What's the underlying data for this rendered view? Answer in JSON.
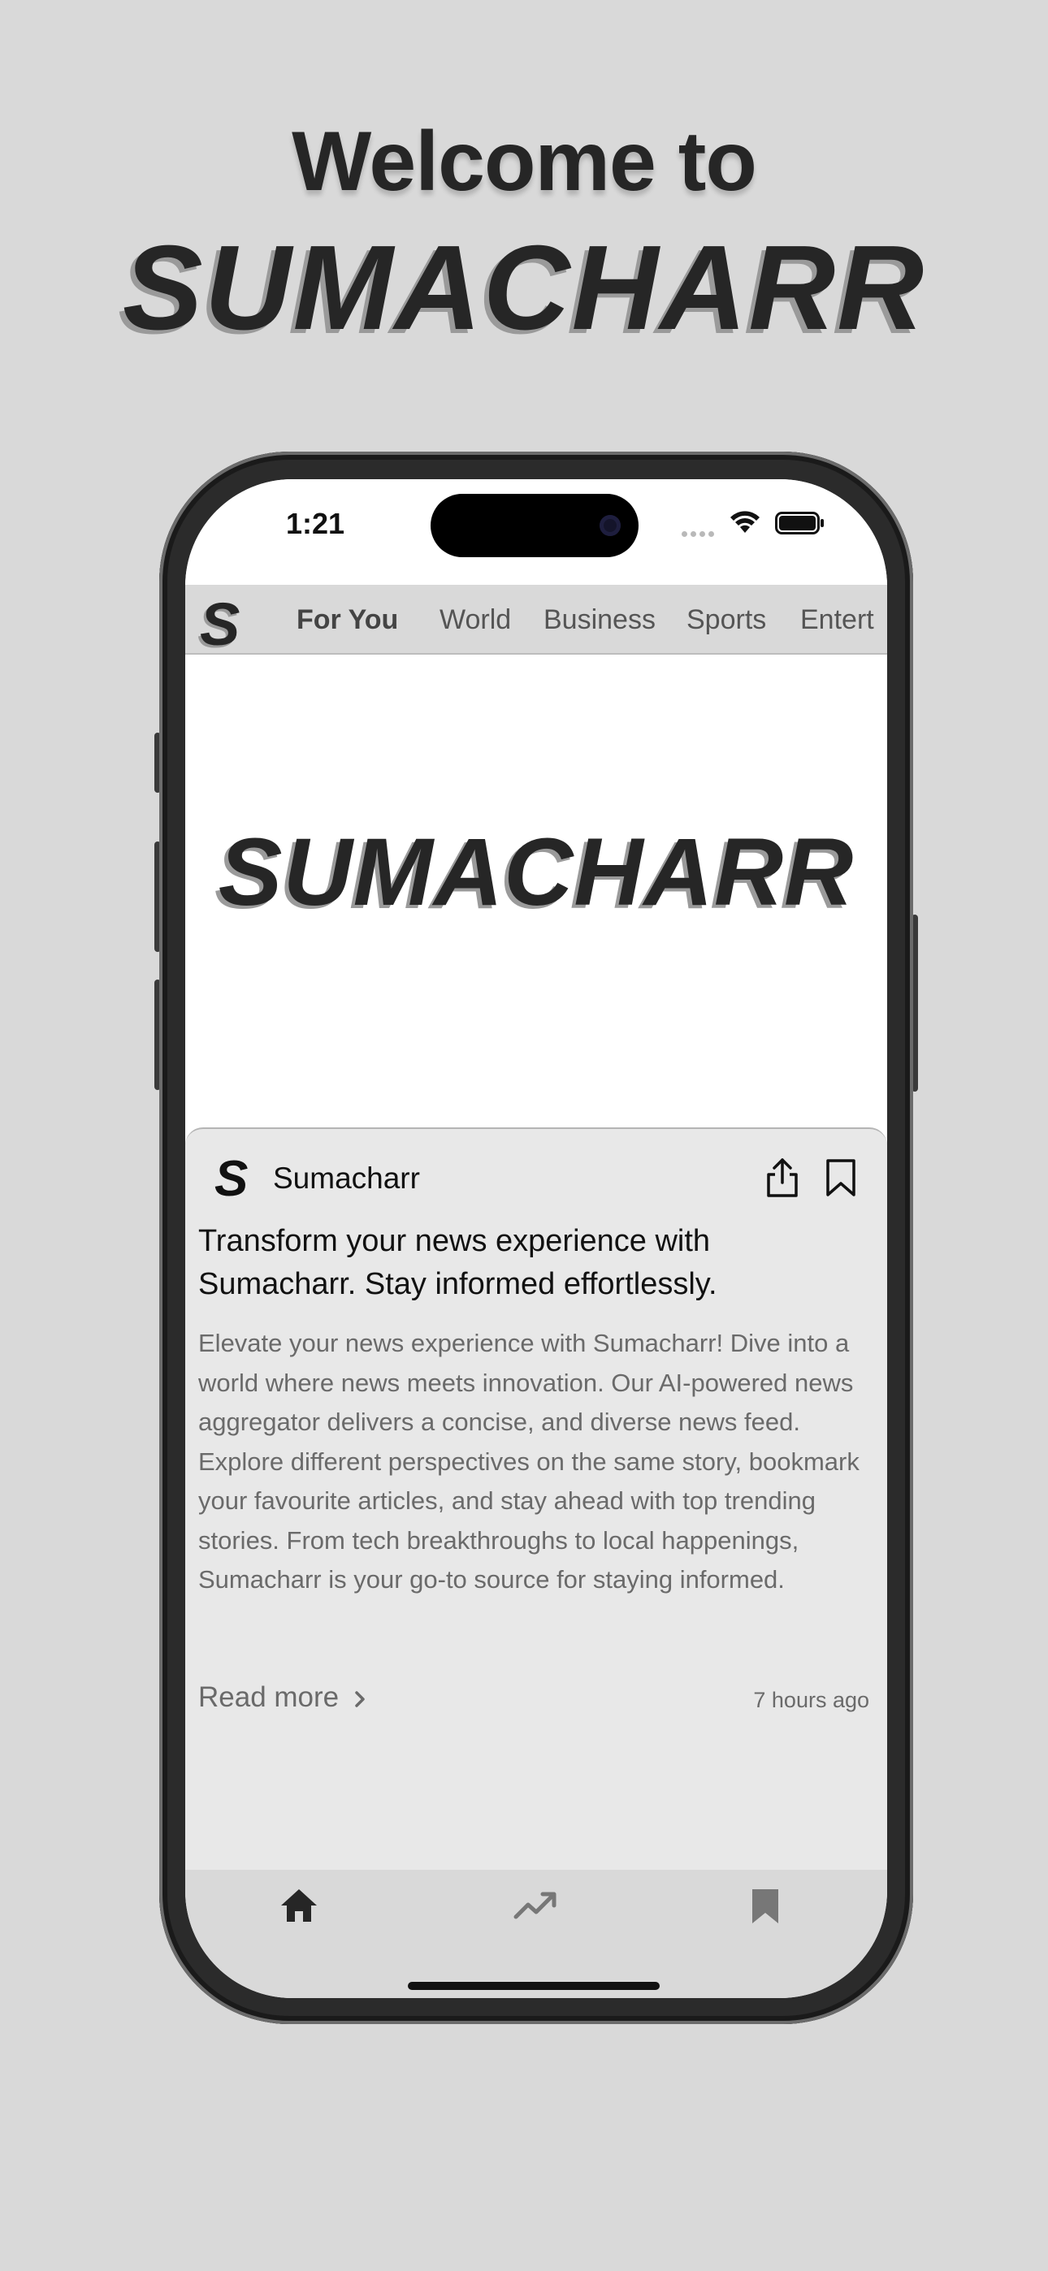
{
  "header": {
    "welcome": "Welcome to",
    "brand": "SUMACHARR"
  },
  "status_bar": {
    "time": "1:21"
  },
  "app": {
    "logo_letter": "S",
    "tabs": [
      {
        "label": "For You",
        "active": true
      },
      {
        "label": "World"
      },
      {
        "label": "Business"
      },
      {
        "label": "Sports"
      },
      {
        "label": "Entert"
      }
    ],
    "hero_brand": "SUMACHARR"
  },
  "article": {
    "source_logo": "S",
    "source": "Sumacharr",
    "title": "Transform your news experience with Sumacharr. Stay informed effortlessly.",
    "body": "Elevate your news experience with Sumacharr! Dive into a world where news meets innovation. Our AI-powered news aggregator delivers a concise, and diverse news feed. Explore different perspectives on the same story, bookmark your favourite articles, and stay ahead with top trending stories. From tech breakthroughs to local happenings, Sumacharr is your go-to source for staying informed.",
    "read_more": "Read more",
    "timestamp": "7 hours ago",
    "icons": [
      "share-icon",
      "bookmark-icon"
    ]
  },
  "bottom_nav": {
    "items": [
      {
        "icon": "home-icon",
        "active": true
      },
      {
        "icon": "trending-icon"
      },
      {
        "icon": "bookmark-icon"
      }
    ]
  },
  "colors": {
    "background": "#d9d9d9",
    "text_dark": "#262626",
    "text_muted": "#6a6a6a",
    "card": "#e8e8e8"
  }
}
